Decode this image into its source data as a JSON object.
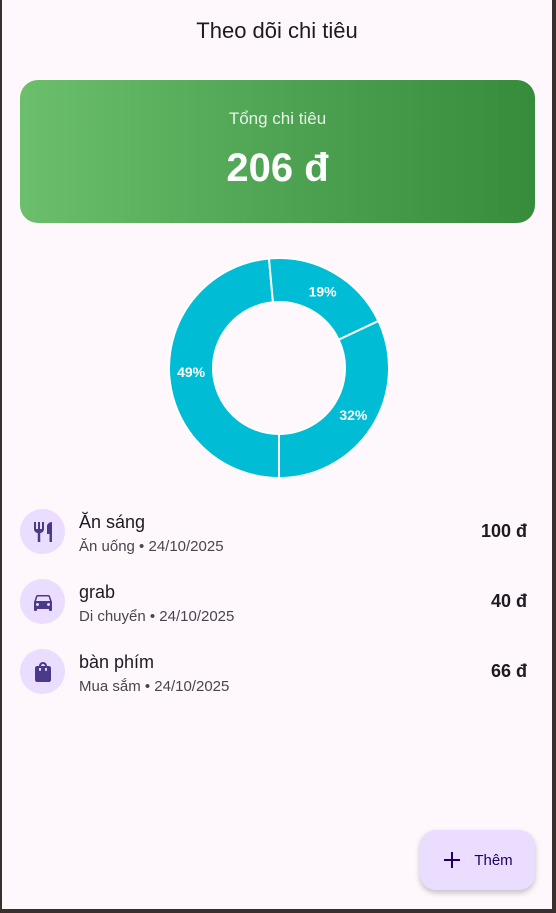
{
  "app": {
    "title": "Theo dõi chi tiêu"
  },
  "summary": {
    "label": "Tổng chi tiêu",
    "value": "206 đ"
  },
  "colors": {
    "donut": "#00bcd4",
    "avatar_bg": "#eaddff",
    "icon": "#4a3a8a"
  },
  "chart_data": {
    "type": "pie",
    "variant": "donut",
    "slices": [
      {
        "category": "Ăn uống",
        "value": 100,
        "label": "49%"
      },
      {
        "category": "Di chuyển",
        "value": 40,
        "label": "19%"
      },
      {
        "category": "Mua sắm",
        "value": 66,
        "label": "32%"
      }
    ]
  },
  "expenses": [
    {
      "name": "Ăn sáng",
      "subtitle": "Ăn uống • 24/10/2025",
      "amount": "100 đ",
      "icon": "restaurant-icon"
    },
    {
      "name": "grab",
      "subtitle": "Di chuyển • 24/10/2025",
      "amount": "40 đ",
      "icon": "car-icon"
    },
    {
      "name": "bàn phím",
      "subtitle": "Mua sắm • 24/10/2025",
      "amount": "66 đ",
      "icon": "shopping-bag-icon"
    }
  ],
  "fab": {
    "label": "Thêm",
    "icon": "plus-icon"
  }
}
